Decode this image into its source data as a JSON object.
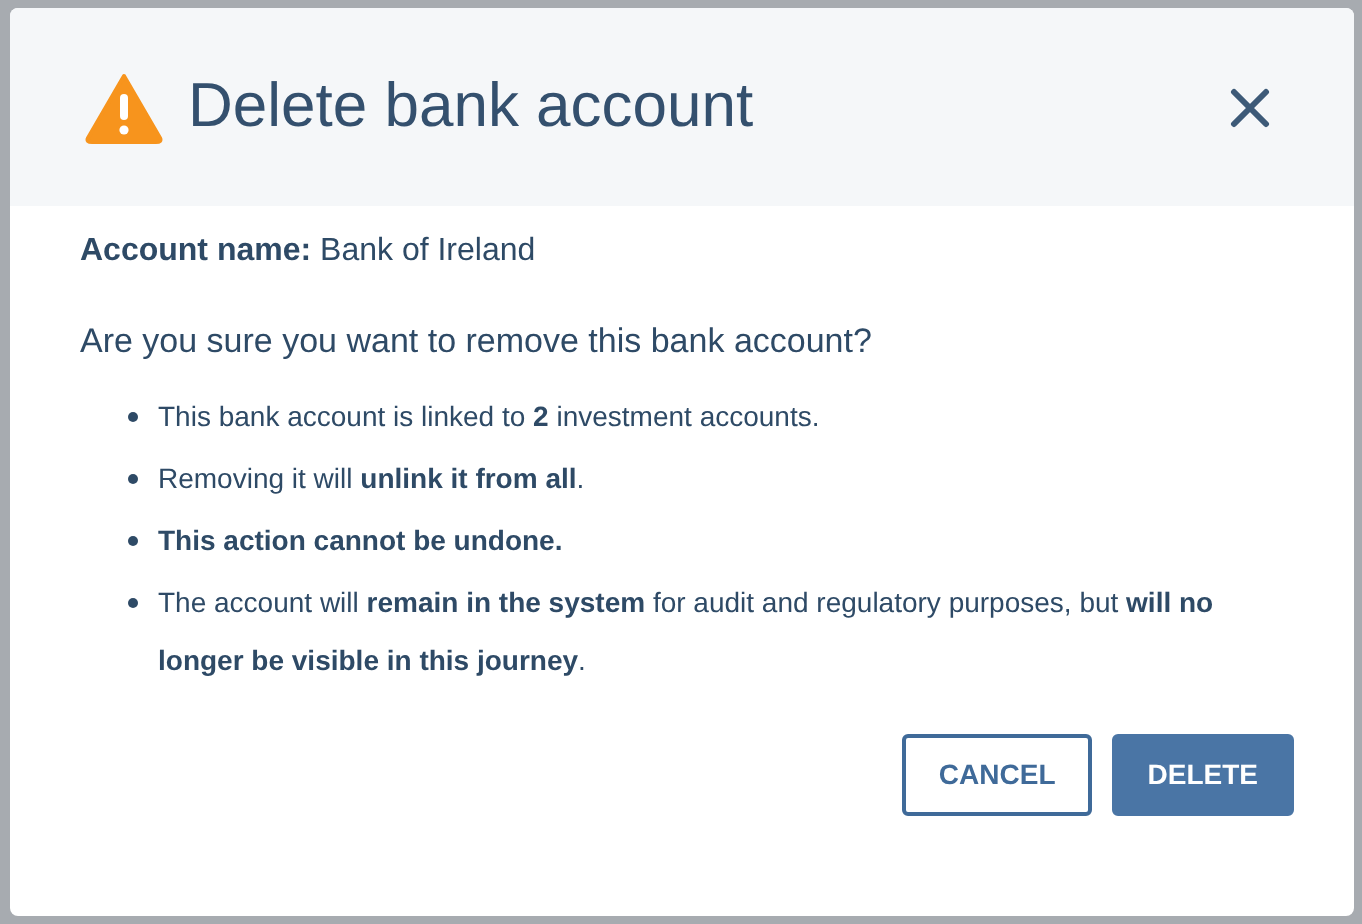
{
  "dialog": {
    "title": "Delete bank account",
    "account_label": "Account name:",
    "account_name": "Bank of Ireland",
    "question": "Are you sure you want to remove this bank account?",
    "bullets": [
      "This bank account is linked to **2** investment accounts.",
      "Removing it will **unlink it from all**.",
      "**This action cannot be undone.**",
      "The account will **remain in the system** for audit and regulatory purposes, but **will no longer be visible in this journey**."
    ],
    "buttons": [
      {
        "label": "CANCEL",
        "kind": "secondary"
      },
      {
        "label": "DELETE",
        "kind": "primary"
      }
    ]
  }
}
